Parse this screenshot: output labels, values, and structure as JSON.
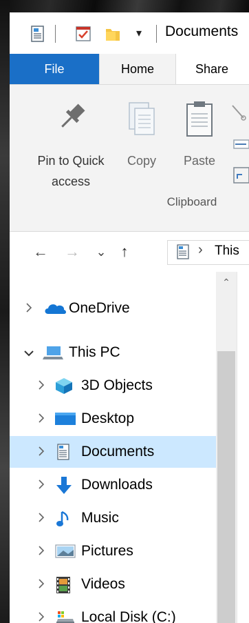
{
  "window": {
    "title": "Documents"
  },
  "quick_access": {
    "properties_icon": "properties-icon",
    "checkmark_icon": "checkmark-icon",
    "folder_icon": "new-folder-icon",
    "customize_icon": "dropdown-arrow-icon",
    "customize_glyph": "▾"
  },
  "tabs": [
    {
      "label": "File"
    },
    {
      "label": "Home"
    },
    {
      "label": "Share"
    }
  ],
  "ribbon": {
    "pin": {
      "label_line1": "Pin to Quick",
      "label_line2": "access"
    },
    "copy": {
      "label": "Copy"
    },
    "paste": {
      "label": "Paste"
    },
    "group_label": "Clipboard"
  },
  "address": {
    "back_glyph": "←",
    "forward_glyph": "→",
    "recent_glyph": "⌄",
    "up_glyph": "↑",
    "separator_glyph": "›",
    "path_text": "This"
  },
  "scroll": {
    "up_glyph": "⌃"
  },
  "nav": {
    "items": [
      {
        "label": "OneDrive",
        "icon": "onedrive-icon",
        "level": 0,
        "expanded": false,
        "selected": false
      },
      {
        "label": "This PC",
        "icon": "this-pc-icon",
        "level": 0,
        "expanded": true,
        "selected": false
      },
      {
        "label": "3D Objects",
        "icon": "3d-objects-icon",
        "level": 1,
        "expanded": false,
        "selected": false
      },
      {
        "label": "Desktop",
        "icon": "desktop-icon",
        "level": 1,
        "expanded": false,
        "selected": false
      },
      {
        "label": "Documents",
        "icon": "documents-icon",
        "level": 1,
        "expanded": false,
        "selected": true
      },
      {
        "label": "Downloads",
        "icon": "downloads-icon",
        "level": 1,
        "expanded": false,
        "selected": false
      },
      {
        "label": "Music",
        "icon": "music-icon",
        "level": 1,
        "expanded": false,
        "selected": false
      },
      {
        "label": "Pictures",
        "icon": "pictures-icon",
        "level": 1,
        "expanded": false,
        "selected": false
      },
      {
        "label": "Videos",
        "icon": "videos-icon",
        "level": 1,
        "expanded": false,
        "selected": false
      },
      {
        "label": "Local Disk (C:)",
        "icon": "local-disk-icon",
        "level": 1,
        "expanded": false,
        "selected": false
      }
    ]
  },
  "colors": {
    "file_tab": "#1a6fc7",
    "selection": "#cce8ff",
    "ribbon_bg": "#f3f3f3"
  }
}
